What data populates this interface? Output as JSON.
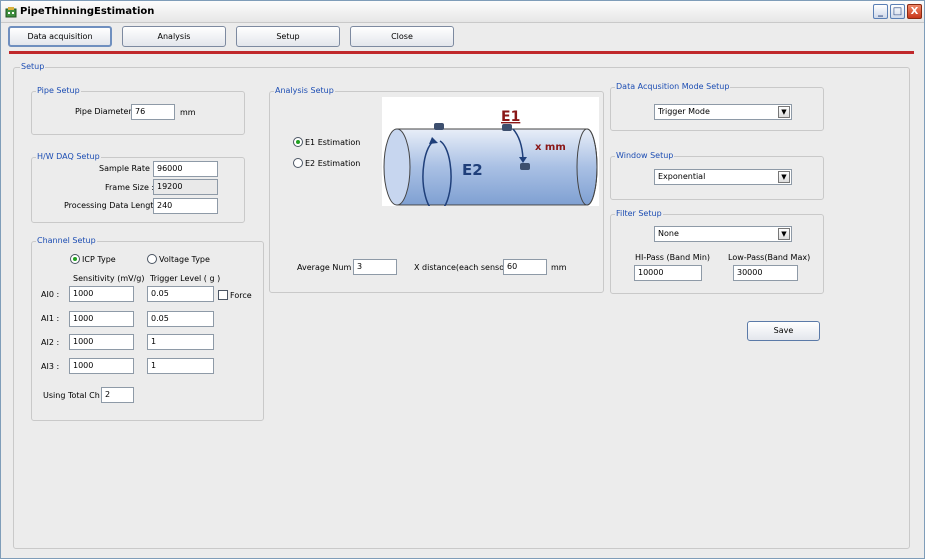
{
  "window": {
    "title": "PipeThinningEstimation"
  },
  "window_controls": {
    "minimize": "_",
    "maximize": "□",
    "close": "X"
  },
  "tabs": [
    "Data acquisition",
    "Analysis",
    "Setup",
    "Close"
  ],
  "setup": {
    "title": "Setup",
    "pipe_setup": {
      "title": "Pipe Setup",
      "diameter_label": "Pipe Diameter :",
      "diameter_value": "76",
      "diameter_unit": "mm"
    },
    "daq_setup": {
      "title": "H/W DAQ Setup",
      "sample_rate_label": "Sample Rate :",
      "sample_rate_value": "96000",
      "frame_size_label": "Frame Size :",
      "frame_size_value": "19200",
      "processing_label": "Processing Data Length :",
      "processing_value": "240"
    },
    "channel_setup": {
      "title": "Channel Setup",
      "icp_label": "ICP Type",
      "voltage_label": "Voltage Type",
      "sensitivity_header": "Sensitivity (mV/g)",
      "trigger_header": "Trigger Level ( g )",
      "force_label": "Force",
      "channels": [
        {
          "name": "AI0 :",
          "sensitivity": "1000",
          "trigger": "0.05"
        },
        {
          "name": "AI1 :",
          "sensitivity": "1000",
          "trigger": "0.05"
        },
        {
          "name": "AI2 :",
          "sensitivity": "1000",
          "trigger": "1"
        },
        {
          "name": "AI3 :",
          "sensitivity": "1000",
          "trigger": "1"
        }
      ],
      "total_ch_label": "Using Total Ch :",
      "total_ch_value": "2"
    },
    "analysis_setup": {
      "title": "Analysis Setup",
      "e1_label": "E1 Estimation",
      "e2_label": "E2 Estimation",
      "average_label": "Average Num :",
      "average_value": "3",
      "xdist_label": "X distance(each sensor) :",
      "xdist_value": "60",
      "xdist_unit": "mm",
      "diagram": {
        "e1": "E1",
        "e2": "E2",
        "xmm": "x mm"
      }
    },
    "daq_mode_setup": {
      "title": "Data Acqusition Mode Setup",
      "selected": "Trigger Mode"
    },
    "window_setup": {
      "title": "Window Setup",
      "selected": "Exponential"
    },
    "filter_setup": {
      "title": "Filter Setup",
      "selected": "None",
      "hipass_label": "HI-Pass  (Band Min)",
      "hipass_value": "10000",
      "lowpass_label": "Low-Pass(Band Max)",
      "lowpass_value": "30000"
    },
    "save_label": "Save"
  },
  "colors": {
    "accent_line": "#c0282b",
    "group_label": "#1c4db3"
  }
}
